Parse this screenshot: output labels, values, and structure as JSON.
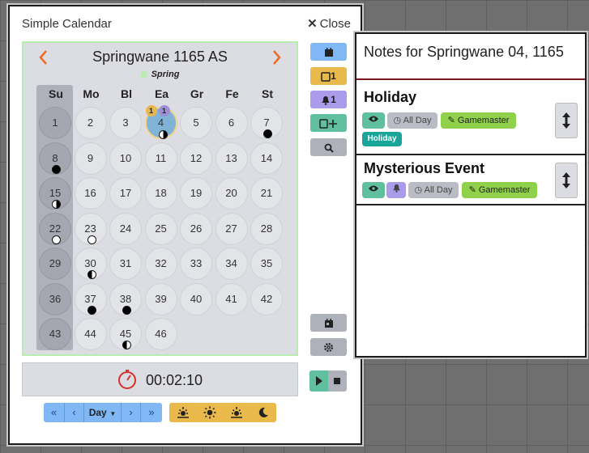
{
  "calendar_window": {
    "title": "Simple Calendar",
    "close_label": "Close",
    "month_title": "Springwane 1165 AS",
    "season": "Spring",
    "weekdays": [
      "Su",
      "Mo",
      "Bl",
      "Ea",
      "Gr",
      "Fe",
      "St"
    ],
    "days": [
      "1",
      "2",
      "3",
      "4",
      "5",
      "6",
      "7",
      "8",
      "9",
      "10",
      "11",
      "12",
      "13",
      "14",
      "15",
      "16",
      "17",
      "18",
      "19",
      "20",
      "21",
      "22",
      "23",
      "24",
      "25",
      "26",
      "27",
      "28",
      "29",
      "30",
      "31",
      "32",
      "33",
      "34",
      "35",
      "36",
      "37",
      "38",
      "39",
      "40",
      "41",
      "42",
      "43",
      "44",
      "45",
      "46"
    ],
    "today": "4",
    "today_badges": {
      "notes": "1",
      "reminders": "1"
    },
    "moon_phases": [
      {
        "day": "4",
        "phase": "first-quarter"
      },
      {
        "day": "7",
        "phase": "new"
      },
      {
        "day": "8",
        "phase": "new"
      },
      {
        "day": "15",
        "phase": "first-quarter"
      },
      {
        "day": "22",
        "phase": "full"
      },
      {
        "day": "23",
        "phase": "full"
      },
      {
        "day": "30",
        "phase": "last-quarter"
      },
      {
        "day": "37",
        "phase": "new"
      },
      {
        "day": "38",
        "phase": "new"
      },
      {
        "day": "45",
        "phase": "last-quarter"
      }
    ],
    "side_buttons": {
      "notes_count": "1",
      "reminders_count": "1"
    },
    "clock_time": "00:02:10",
    "time_step": {
      "unit": "Day",
      "rewind": "«",
      "back": "‹",
      "forward": "›",
      "fast_forward": "»"
    },
    "colors": {
      "accent_orange": "#ee6b29",
      "blue": "#7fb8f5",
      "yellow": "#e9b94c",
      "purple": "#ab9ceb",
      "teal": "#5fbf9f",
      "grey": "#aeb1b9"
    }
  },
  "notes_window": {
    "title": "Notes for Springwane 04, 1165",
    "notes": [
      {
        "title": "Holiday",
        "time_label": "All Day",
        "author": "Gamemaster",
        "tag": "Holiday",
        "has_reminder": false
      },
      {
        "title": "Mysterious Event",
        "time_label": "All Day",
        "author": "Gamemaster",
        "has_reminder": true
      }
    ]
  }
}
